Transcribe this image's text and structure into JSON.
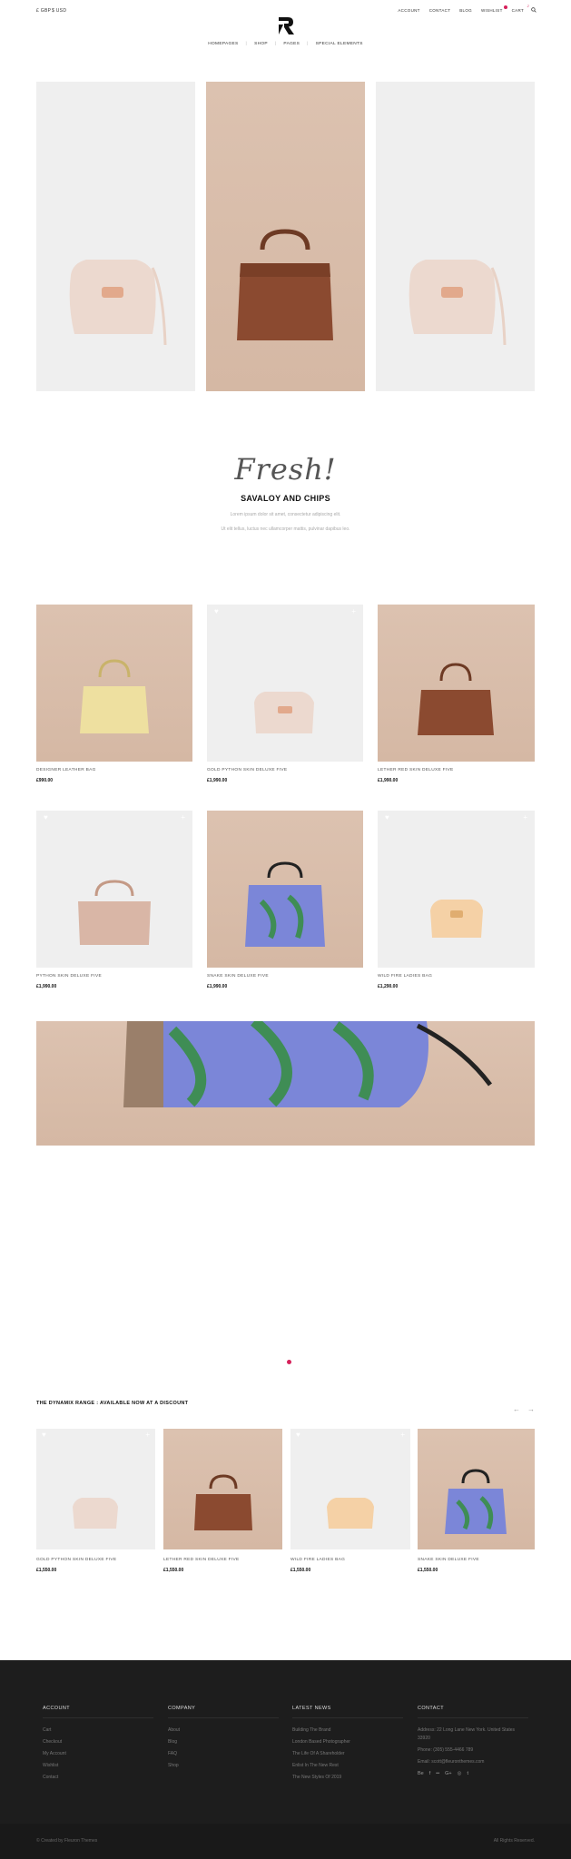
{
  "header": {
    "currency": [
      "£ GBP",
      "$ USD"
    ],
    "links": [
      "ACCOUNT",
      "CONTACT",
      "BLOG",
      "WISHLIST",
      "CART"
    ],
    "cart_count": "2",
    "nav": [
      "HOMEPAGES",
      "SHOP",
      "PAGES",
      "SPECIAL ELEMENTS"
    ]
  },
  "feature": {
    "script": "Fresh!",
    "title": "SAVALOY AND CHIPS",
    "line1": "Lorem ipsum dolor sit amet, consectetur adipiscing elit.",
    "line2": "Ut elit tellus, luctus nec ullamcorper mattis, pulvinar dapibus leo."
  },
  "products": [
    {
      "name": "DESIGNER LEATHER BAG",
      "price": "£990.00"
    },
    {
      "name": "GOLD PYTHON SKIN DELUXE FIVE",
      "price": "£1,990.00"
    },
    {
      "name": "LETHER RED SKIN DELUXE FIVE",
      "price": "£1,990.00"
    },
    {
      "name": "PYTHON SKIN DELUXE FIVE",
      "price": "£1,990.00"
    },
    {
      "name": "SNAKE SKIN DELUXE FIVE",
      "price": "£1,990.00"
    },
    {
      "name": "WILD FIRE LADIES BAG",
      "price": "£1,290.00"
    }
  ],
  "range": {
    "title": "THE DYNAMIX RANGE : AVAILABLE NOW AT A DISCOUNT",
    "items": [
      {
        "name": "GOLD PYTHON SKIN DELUXE FIVE",
        "price": "£1,550.00"
      },
      {
        "name": "LETHER RED SKIN DELUXE FIVE",
        "price": "£1,550.00"
      },
      {
        "name": "WILD FIRE LADIES BAG",
        "price": "£1,550.00"
      },
      {
        "name": "SNAKE SKIN DELUXE FIVE",
        "price": "£1,550.00"
      }
    ]
  },
  "footer": {
    "account": {
      "title": "ACCOUNT",
      "links": [
        "Cart",
        "Checkout",
        "My Account",
        "Wishlist",
        "Contact"
      ]
    },
    "company": {
      "title": "COMPANY",
      "links": [
        "About",
        "Blog",
        "FAQ",
        "Shop"
      ]
    },
    "news": {
      "title": "LATEST NEWS",
      "links": [
        "Building The Brand",
        "London Based Photographer",
        "The Life Of A Shareholder",
        "Enlist In The New Rest",
        "The New Styles Of 2019"
      ]
    },
    "contact": {
      "title": "CONTACT",
      "address": "Address: 22 Long Lane New York. United States",
      "zip": "33920",
      "phone": "Phone: (305) 555-4466 789",
      "email": "Email: scott@fleuronthemes.com"
    },
    "social": [
      "Be",
      "f",
      "••",
      "G+",
      "◎",
      "t"
    ],
    "copyright": "© Created by Fleuron Themes",
    "rights": "All Rights Reserved."
  }
}
